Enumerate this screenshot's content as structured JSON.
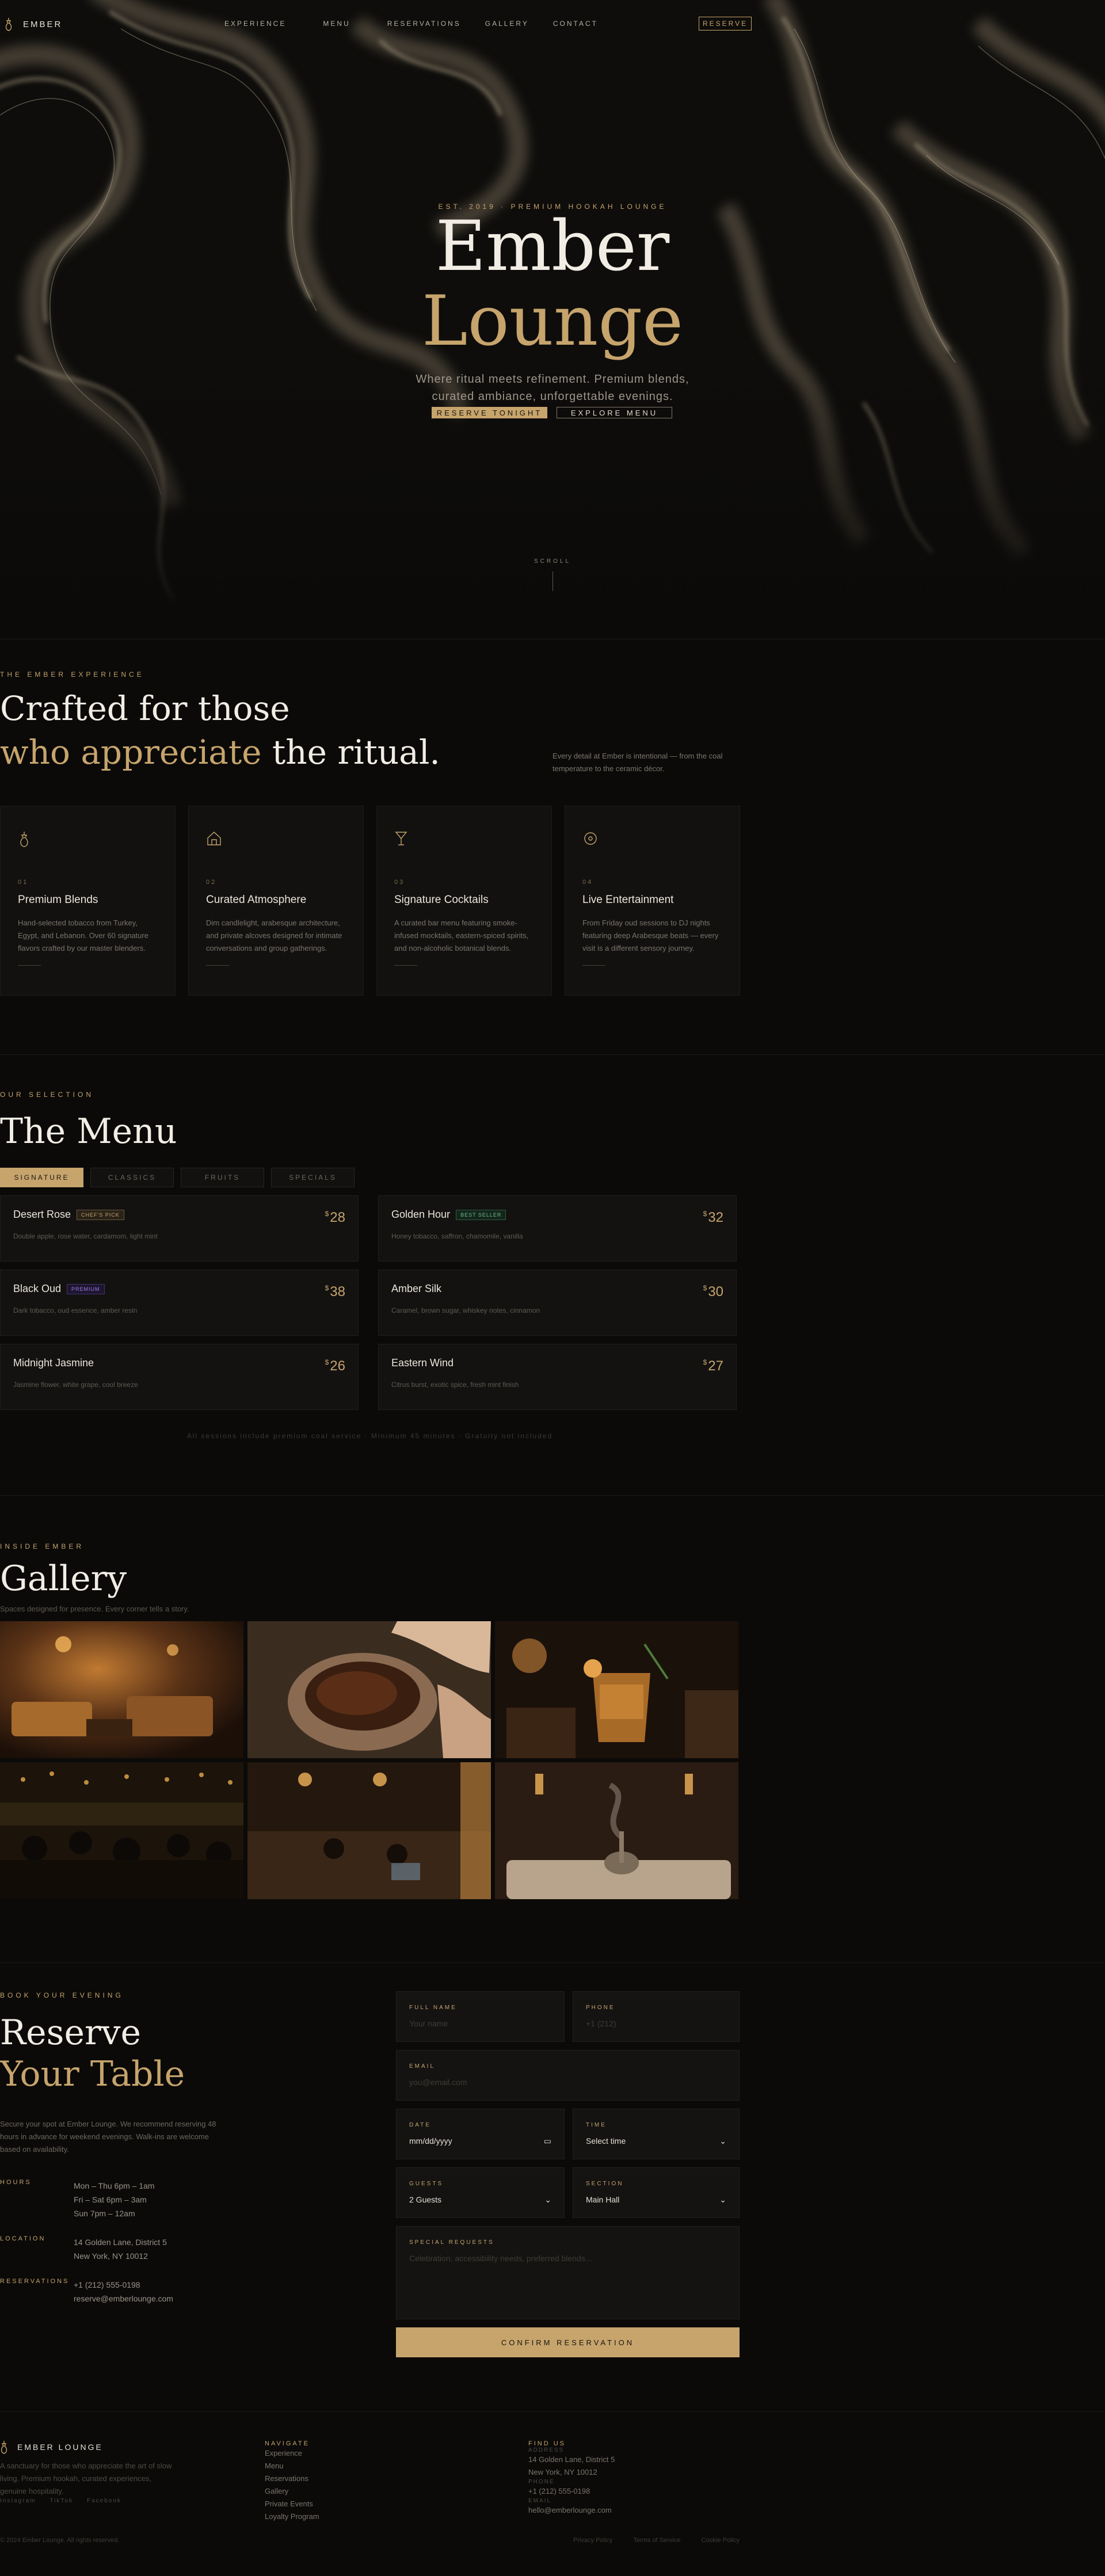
{
  "nav": {
    "brand": "EMBER",
    "links": [
      "EXPERIENCE",
      "MENU",
      "RESERVATIONS",
      "GALLERY",
      "CONTACT"
    ],
    "reserve": "RESERVE"
  },
  "hero": {
    "eyebrow": "EST. 2019 · PREMIUM HOOKAH LOUNGE",
    "title_1": "Ember",
    "title_2": "Lounge",
    "subtitle_1": "Where ritual meets refinement. Premium blends,",
    "subtitle_2": "curated ambiance, unforgettable evenings.",
    "primary_button": "RESERVE TONIGHT",
    "secondary_button": "EXPLORE MENU",
    "scroll": "SCROLL"
  },
  "experience": {
    "label": "THE EMBER EXPERIENCE",
    "heading_1": "Crafted for those",
    "heading_2_gold": "who appreciate",
    "heading_2_rest": " the ritual.",
    "note": "Every detail at Ember is intentional — from the coal temperature to the ceramic décor.",
    "cards": [
      {
        "icon": "hookah-icon",
        "num": "01",
        "title": "Premium Blends",
        "text": "Hand-selected tobacco from Turkey, Egypt, and Lebanon. Over 60 signature flavors crafted by our master blenders."
      },
      {
        "icon": "home-icon",
        "num": "02",
        "title": "Curated Atmosphere",
        "text": "Dim candlelight, arabesque architecture, and private alcoves designed for intimate conversations and group gatherings."
      },
      {
        "icon": "cocktail-icon",
        "num": "03",
        "title": "Signature Cocktails",
        "text": "A curated bar menu featuring smoke-infused mocktails, eastern-spiced spirits, and non-alcoholic botanical blends."
      },
      {
        "icon": "music-icon",
        "num": "04",
        "title": "Live Entertainment",
        "text": "From Friday oud sessions to DJ nights featuring deep Arabesque beats — every visit is a different sensory journey."
      }
    ]
  },
  "menu": {
    "label": "OUR SELECTION",
    "heading": "The Menu",
    "tabs": [
      "SIGNATURE",
      "CLASSICS",
      "FRUITS",
      "SPECIALS"
    ],
    "items": [
      {
        "name": "Desert Rose",
        "badge": "CHEF'S PICK",
        "badge_type": "chef",
        "desc": "Double apple, rose water, cardamom, light mint",
        "price": "28"
      },
      {
        "name": "Golden Hour",
        "badge": "BEST SELLER",
        "badge_type": "best",
        "desc": "Honey tobacco, saffron, chamomile, vanilla",
        "price": "32"
      },
      {
        "name": "Black Oud",
        "badge": "PREMIUM",
        "badge_type": "prem",
        "desc": "Dark tobacco, oud essence, amber resin",
        "price": "38"
      },
      {
        "name": "Amber Silk",
        "badge": "",
        "badge_type": "",
        "desc": "Caramel, brown sugar, whiskey notes, cinnamon",
        "price": "30"
      },
      {
        "name": "Midnight Jasmine",
        "badge": "",
        "badge_type": "",
        "desc": "Jasmine flower, white grape, cool breeze",
        "price": "26"
      },
      {
        "name": "Eastern Wind",
        "badge": "",
        "badge_type": "",
        "desc": "Citrus burst, exotic spice, fresh mint finish",
        "price": "27"
      }
    ],
    "currency": "$",
    "footnote": "All sessions include premium coal service · Minimum 45 minutes · Gratuity not included"
  },
  "gallery": {
    "label": "INSIDE EMBER",
    "heading": "Gallery",
    "subtitle": "Spaces designed for presence. Every corner tells a story."
  },
  "reserve": {
    "label": "BOOK YOUR EVENING",
    "heading_1": "Reserve",
    "heading_2": "Your Table",
    "intro": "Secure your spot at Ember Lounge. We recommend reserving 48 hours in advance for weekend evenings. Walk-ins are welcome based on availability.",
    "hours_label": "HOURS",
    "hours": [
      "Mon – Thu 6pm – 1am",
      "Fri – Sat 6pm – 3am",
      "Sun 7pm – 12am"
    ],
    "location_label": "LOCATION",
    "location": [
      "14 Golden Lane, District 5",
      "New York, NY 10012"
    ],
    "reservations_label": "RESERVATIONS",
    "reservations": [
      "+1 (212) 555-0198",
      "reserve@emberlounge.com"
    ],
    "form": {
      "full_name_label": "FULL NAME",
      "full_name_placeholder": "Your name",
      "phone_label": "PHONE",
      "phone_placeholder": "+1 (212)",
      "email_label": "EMAIL",
      "email_placeholder": "you@email.com",
      "date_label": "DATE",
      "date_value": "mm/dd/yyyy",
      "time_label": "TIME",
      "time_value": "Select time",
      "guests_label": "GUESTS",
      "guests_value": "2 Guests",
      "section_label": "SECTION",
      "section_value": "Main Hall",
      "requests_label": "SPECIAL REQUESTS",
      "requests_placeholder": "Celebration, accessibility needs, preferred blends...",
      "submit": "CONFIRM RESERVATION"
    }
  },
  "footer": {
    "brand": "EMBER LOUNGE",
    "tagline": "A sanctuary for those who appreciate the art of slow living. Premium hookah, curated experiences, genuine hospitality.",
    "social": [
      "Instagram",
      "TikTok",
      "Facebook"
    ],
    "navigate_label": "NAVIGATE",
    "navigate": [
      "Experience",
      "Menu",
      "Reservations",
      "Gallery",
      "Private Events",
      "Loyalty Program"
    ],
    "find_label": "FIND US",
    "address_label": "ADDRESS",
    "address": [
      "14 Golden Lane, District 5",
      "New York, NY 10012"
    ],
    "phone_label": "PHONE",
    "phone": "+1 (212) 555-0198",
    "email_label": "EMAIL",
    "email": "hello@emberlounge.com",
    "copyright": "© 2024 Ember Lounge. All rights reserved.",
    "legal": [
      "Privacy Policy",
      "Terms of Service",
      "Cookie Policy"
    ]
  },
  "colors": {
    "accent": "#c6a46c",
    "background": "#0b0a09",
    "card": "#121110"
  }
}
